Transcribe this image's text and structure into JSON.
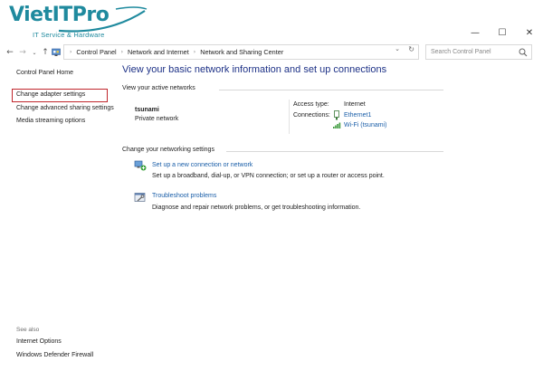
{
  "watermark": {
    "brand": "VietITPro",
    "tagline": "IT Service & Hardware",
    "color": "#1f8a9e"
  },
  "window": {
    "minimize_glyph": "—",
    "maximize_glyph": "☐",
    "close_glyph": "✕"
  },
  "nav": {
    "back": "←",
    "forward": "→",
    "up": "↑",
    "dropdown": "⌄",
    "refresh": "↻"
  },
  "address": {
    "breadcrumbs": [
      "Control Panel",
      "Network and Internet",
      "Network and Sharing Center"
    ]
  },
  "search": {
    "placeholder": "Search Control Panel"
  },
  "left_pane": {
    "items": [
      "Control Panel Home",
      "Change adapter settings",
      "Change advanced sharing settings",
      "Media streaming options"
    ],
    "highlighted_item": "Change adapter settings",
    "highlight_color": "#c0262c",
    "see_also_label": "See also",
    "see_also_items": [
      "Internet Options",
      "Windows Defender Firewall"
    ]
  },
  "main": {
    "title": "View your basic network information and set up connections",
    "active_networks_heading": "View your active networks",
    "network_name": "tsunami",
    "network_type": "Private network",
    "access_type_label": "Access type:",
    "access_type_value": "Internet",
    "connections_label": "Connections:",
    "connections": [
      "Ethernet1",
      "Wi-Fi (tsunami)"
    ],
    "change_settings_heading": "Change your networking settings",
    "tasks": [
      {
        "title": "Set up a new connection or network",
        "desc": "Set up a broadband, dial-up, or VPN connection; or set up a router or access point.",
        "icon": "network-setup-icon"
      },
      {
        "title": "Troubleshoot problems",
        "desc": "Diagnose and repair network problems, or get troubleshooting information.",
        "icon": "troubleshoot-icon"
      }
    ]
  }
}
